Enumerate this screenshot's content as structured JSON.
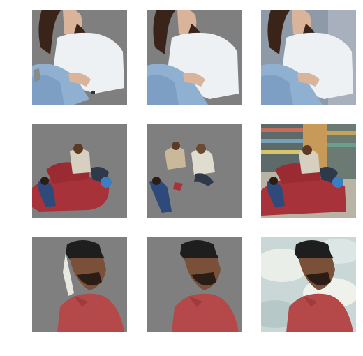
{
  "figure": {
    "rows": 3,
    "cols": 3,
    "mask_background": "#7f7f7f",
    "page_background": "#ffffff",
    "panels": [
      {
        "row": 0,
        "col": 0,
        "subject": "woman-seated",
        "variant": "cutout-a"
      },
      {
        "row": 0,
        "col": 1,
        "subject": "woman-seated",
        "variant": "cutout-b"
      },
      {
        "row": 0,
        "col": 2,
        "subject": "woman-seated",
        "variant": "original"
      },
      {
        "row": 1,
        "col": 0,
        "subject": "people-on-beanbags",
        "variant": "cutout-a"
      },
      {
        "row": 1,
        "col": 1,
        "subject": "people-on-beanbags",
        "variant": "cutout-b"
      },
      {
        "row": 1,
        "col": 2,
        "subject": "people-on-beanbags",
        "variant": "original"
      },
      {
        "row": 2,
        "col": 0,
        "subject": "man-in-cap",
        "variant": "cutout-a"
      },
      {
        "row": 2,
        "col": 1,
        "subject": "man-in-cap",
        "variant": "cutout-b"
      },
      {
        "row": 2,
        "col": 2,
        "subject": "man-in-cap",
        "variant": "original"
      }
    ]
  }
}
